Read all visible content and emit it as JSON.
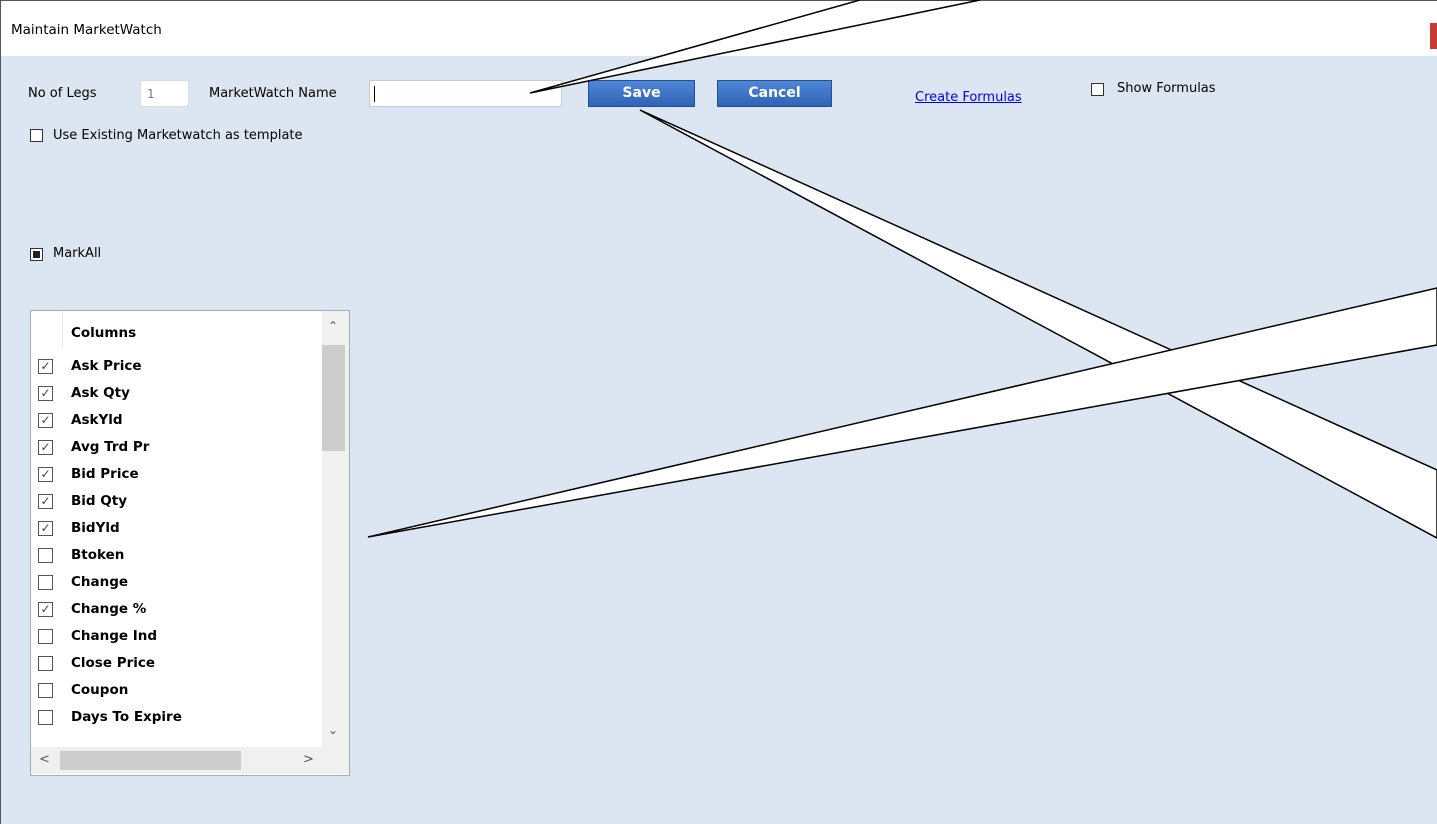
{
  "window": {
    "title": "Maintain MarketWatch"
  },
  "form": {
    "no_of_legs_label": "No of Legs",
    "no_of_legs_value": "1",
    "name_label": "MarketWatch Name",
    "name_value": "",
    "save_label": "Save",
    "cancel_label": "Cancel",
    "create_formulas_label": "Create Formulas",
    "show_formulas_label": "Show Formulas",
    "use_existing_label": "Use Existing Marketwatch as template",
    "mark_all_label": "MarkAll"
  },
  "columns_panel": {
    "header": "Columns",
    "items": [
      {
        "label": "Ask Price",
        "checked": true
      },
      {
        "label": "Ask Qty",
        "checked": true
      },
      {
        "label": "AskYld",
        "checked": true
      },
      {
        "label": "Avg Trd Pr",
        "checked": true
      },
      {
        "label": "Bid Price",
        "checked": true
      },
      {
        "label": "Bid Qty",
        "checked": true
      },
      {
        "label": "BidYld",
        "checked": true
      },
      {
        "label": "Btoken",
        "checked": false
      },
      {
        "label": "Change",
        "checked": false
      },
      {
        "label": "Change %",
        "checked": true
      },
      {
        "label": "Change Ind",
        "checked": false
      },
      {
        "label": "Close Price",
        "checked": false
      },
      {
        "label": "Coupon",
        "checked": false
      },
      {
        "label": "Days To Expire",
        "checked": false
      }
    ]
  },
  "colors": {
    "background": "#dce6f3",
    "button": "#2f63b7",
    "close": "#c83a32",
    "link": "#0000ee"
  }
}
